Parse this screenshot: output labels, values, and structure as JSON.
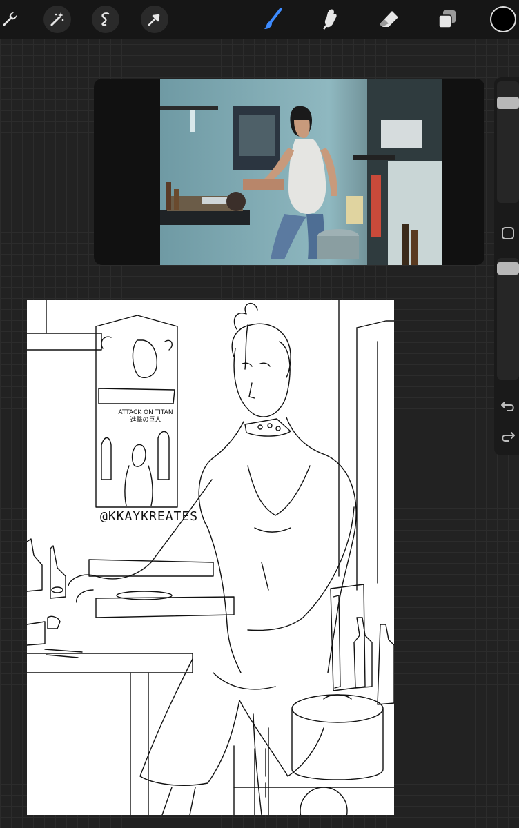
{
  "toolbar": {
    "tools": [
      {
        "name": "wrench-icon",
        "active": false
      },
      {
        "name": "magic-wand-icon",
        "active": false
      },
      {
        "name": "selection-icon",
        "active": false
      },
      {
        "name": "transform-arrow-icon",
        "active": false
      },
      {
        "name": "brush-icon",
        "active": true
      },
      {
        "name": "smudge-icon",
        "active": false
      },
      {
        "name": "eraser-icon",
        "active": false
      },
      {
        "name": "layers-icon",
        "active": false
      }
    ],
    "active_color": "#000000",
    "accent_color": "#3d8bff"
  },
  "canvas": {
    "watermark": "@KKAYKREATES",
    "poster_text": "ATTACK ON TITAN 進撃の巨人"
  },
  "sidebar": {
    "brush_size_level": 0.14,
    "opacity_level": 0.04,
    "buttons": [
      "modify-button-icon",
      "undo-icon",
      "redo-icon"
    ]
  }
}
